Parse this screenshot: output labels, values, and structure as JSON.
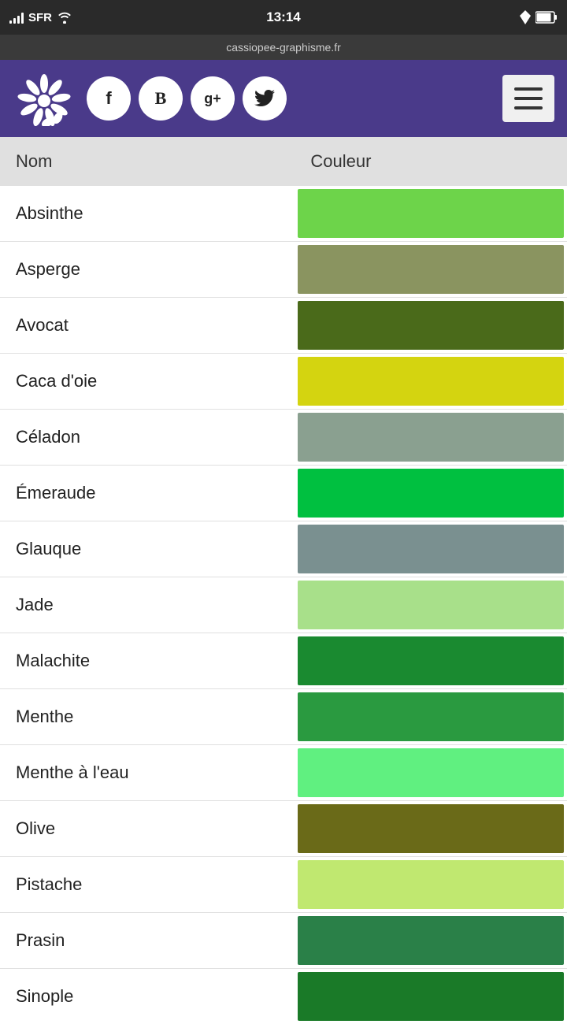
{
  "statusBar": {
    "carrier": "SFR",
    "time": "13:14",
    "url": "cassiopee-graphisme.fr"
  },
  "header": {
    "socialIcons": [
      {
        "id": "facebook",
        "label": "f"
      },
      {
        "id": "blogger",
        "label": "B"
      },
      {
        "id": "googleplus",
        "label": "g+"
      },
      {
        "id": "twitter",
        "label": "🐦"
      }
    ],
    "menuLabel": "Menu"
  },
  "table": {
    "headers": [
      "Nom",
      "Couleur"
    ],
    "rows": [
      {
        "name": "Absinthe",
        "color": "#6dd44a"
      },
      {
        "name": "Asperge",
        "color": "#8a9460"
      },
      {
        "name": "Avocat",
        "color": "#4a6a1a"
      },
      {
        "name": "Caca d'oie",
        "color": "#d4d410"
      },
      {
        "name": "Céladon",
        "color": "#8aa090"
      },
      {
        "name": "Émeraude",
        "color": "#00c040"
      },
      {
        "name": "Glauque",
        "color": "#7a9090"
      },
      {
        "name": "Jade",
        "color": "#a8e08a"
      },
      {
        "name": "Malachite",
        "color": "#1a8a30"
      },
      {
        "name": "Menthe",
        "color": "#2a9a40"
      },
      {
        "name": "Menthe à l'eau",
        "color": "#60f080"
      },
      {
        "name": "Olive",
        "color": "#6a6a18"
      },
      {
        "name": "Pistache",
        "color": "#c0e870"
      },
      {
        "name": "Prasin",
        "color": "#2a8048"
      },
      {
        "name": "Sinople",
        "color": "#1a7a28"
      }
    ]
  }
}
